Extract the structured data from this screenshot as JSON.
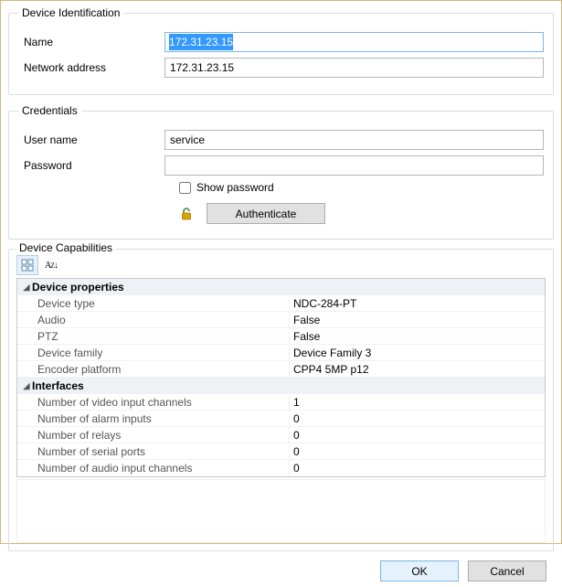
{
  "identification": {
    "legend": "Device Identification",
    "name_label": "Name",
    "name_value": "172.31.23.15",
    "addr_label": "Network address",
    "addr_value": "172.31.23.15"
  },
  "credentials": {
    "legend": "Credentials",
    "user_label": "User name",
    "user_value": "service",
    "pass_label": "Password",
    "pass_value": "",
    "show_pass_label": "Show password",
    "auth_button": "Authenticate"
  },
  "capabilities": {
    "legend": "Device Capabilities",
    "groups": [
      {
        "title": "Device properties",
        "rows": [
          {
            "key": "Device type",
            "val": "NDC-284-PT"
          },
          {
            "key": "Audio",
            "val": "False"
          },
          {
            "key": "PTZ",
            "val": "False"
          },
          {
            "key": "Device family",
            "val": "Device Family 3"
          },
          {
            "key": "Encoder platform",
            "val": "CPP4 5MP p12"
          }
        ]
      },
      {
        "title": "Interfaces",
        "rows": [
          {
            "key": "Number of video input channels",
            "val": "1"
          },
          {
            "key": "Number of alarm inputs",
            "val": "0"
          },
          {
            "key": "Number of relays",
            "val": "0"
          },
          {
            "key": "Number of serial ports",
            "val": "0"
          },
          {
            "key": "Number of audio input channels",
            "val": "0"
          }
        ]
      }
    ]
  },
  "buttons": {
    "ok": "OK",
    "cancel": "Cancel"
  }
}
